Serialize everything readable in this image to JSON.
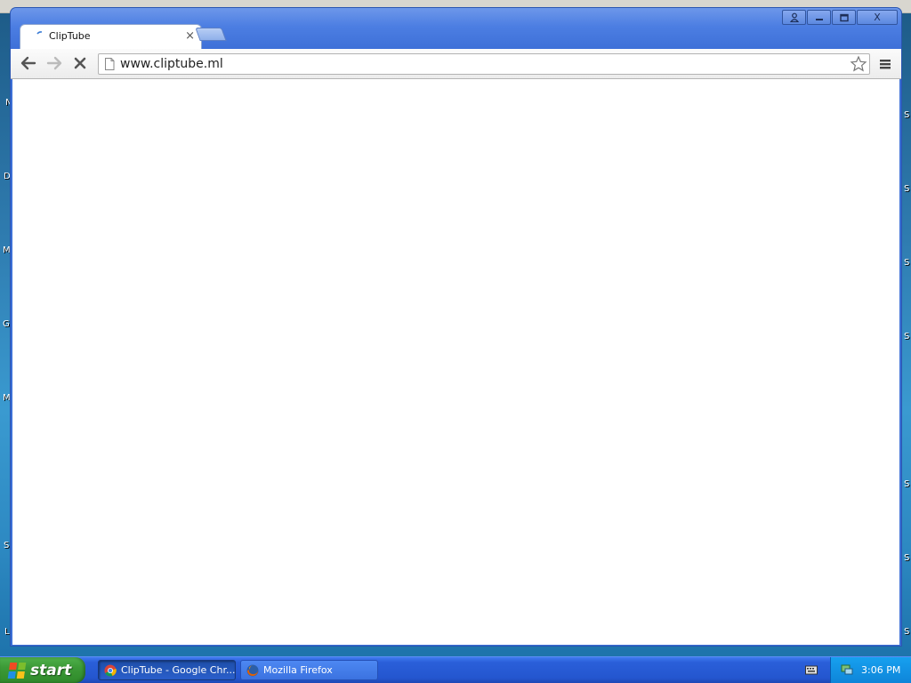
{
  "desktop": {
    "left_letters": [
      "N",
      "D",
      "M",
      "G",
      "M",
      "S",
      "L"
    ],
    "right_letters": [
      "S",
      "S",
      "S",
      "S",
      "S",
      "S",
      "S"
    ]
  },
  "browser": {
    "tab": {
      "title": "ClipTube",
      "close_glyph": "×"
    },
    "window_controls": {
      "profile_glyph": "👤",
      "minimize_glyph": "–",
      "maximize_glyph": "□",
      "close_glyph": "X"
    },
    "toolbar": {
      "url": "www.cliptube.ml"
    }
  },
  "taskbar": {
    "start_label": "start",
    "tasks": [
      {
        "label": "ClipTube - Google Chr...",
        "icon": "chrome-icon",
        "active": true
      },
      {
        "label": "Mozilla Firefox",
        "icon": "firefox-icon",
        "active": false
      }
    ],
    "clock": "3:06 PM"
  }
}
